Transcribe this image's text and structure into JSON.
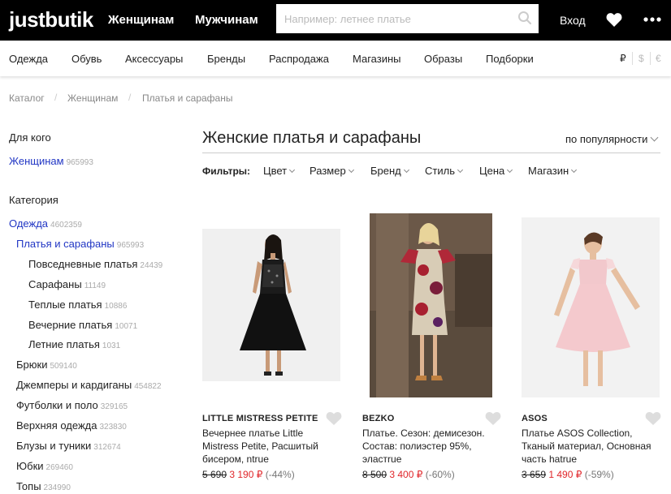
{
  "header": {
    "logo": "justbutik",
    "nav_women": "Женщинам",
    "nav_men": "Мужчинам",
    "search_placeholder": "Например: летнее платье",
    "login": "Вход"
  },
  "categories": [
    "Одежда",
    "Обувь",
    "Аксессуары",
    "Бренды",
    "Распродажа",
    "Магазины",
    "Образы",
    "Подборки"
  ],
  "currencies": [
    "₽",
    "$",
    "€"
  ],
  "breadcrumbs": [
    "Каталог",
    "Женщинам",
    "Платья и сарафаны"
  ],
  "sidebar": {
    "for_whom_title": "Для кого",
    "for_whom": {
      "label": "Женщинам",
      "count": "965993"
    },
    "category_title": "Категория",
    "items": [
      {
        "label": "Одежда",
        "count": "4602359"
      },
      {
        "label": "Платья и сарафаны",
        "count": "965993"
      },
      {
        "label": "Повседневные платья",
        "count": "24439"
      },
      {
        "label": "Сарафаны",
        "count": "11149"
      },
      {
        "label": "Теплые платья",
        "count": "10886"
      },
      {
        "label": "Вечерние платья",
        "count": "10071"
      },
      {
        "label": "Летние платья",
        "count": "1031"
      },
      {
        "label": "Брюки",
        "count": "509140"
      },
      {
        "label": "Джемперы и кардиганы",
        "count": "454822"
      },
      {
        "label": "Футболки и поло",
        "count": "329165"
      },
      {
        "label": "Верхняя одежда",
        "count": "323830"
      },
      {
        "label": "Блузы и туники",
        "count": "312674"
      },
      {
        "label": "Юбки",
        "count": "269460"
      },
      {
        "label": "Топы",
        "count": "234990"
      }
    ]
  },
  "main": {
    "title": "Женские платья и сарафаны",
    "sort": "по популярности",
    "filters_label": "Фильтры:",
    "filters": [
      "Цвет",
      "Размер",
      "Бренд",
      "Стиль",
      "Цена",
      "Магазин"
    ]
  },
  "products": [
    {
      "brand": "LITTLE MISTRESS PETITE",
      "desc": "Вечернее платье Little Mistress Petite, Расшитый бисером, ntrue",
      "old_price": "5 690",
      "new_price": "3 190 ₽",
      "discount": "(-44%)"
    },
    {
      "brand": "BEZKO",
      "desc": "Платье. Сезон: демисезон. Состав: полиэстер 95%, эластrue",
      "old_price": "8 500",
      "new_price": "3 400 ₽",
      "discount": "(-60%)"
    },
    {
      "brand": "ASOS",
      "desc": "Платье ASOS Collection, Тканый материал, Основная часть hatrue",
      "old_price": "3 659",
      "new_price": "1 490 ₽",
      "discount": "(-59%)"
    }
  ],
  "colors": {
    "link_blue": "#2136c4",
    "price_red": "#e0262a",
    "top_bar": "#000000"
  }
}
